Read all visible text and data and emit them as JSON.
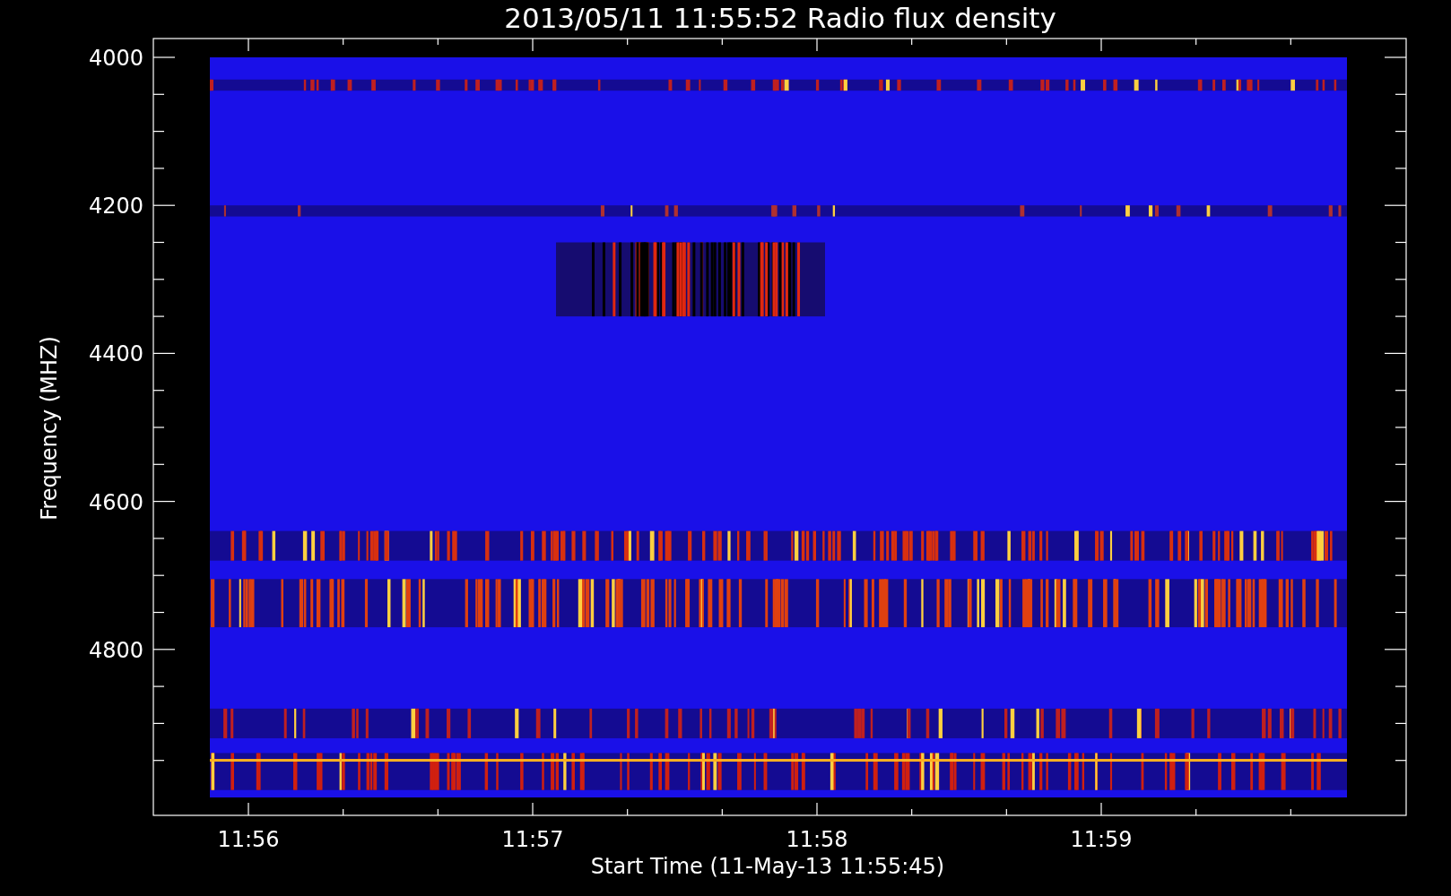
{
  "title": "2013/05/11 11:55:52 Radio flux density",
  "y_axis": {
    "label": "Frequency (MHZ)",
    "ticks": [
      "4000",
      "4200",
      "4400",
      "4600",
      "4800"
    ]
  },
  "x_axis": {
    "label": "Start Time (11-May-13 11:55:45)",
    "ticks": [
      "11:56",
      "11:57",
      "11:58",
      "11:59"
    ]
  }
}
